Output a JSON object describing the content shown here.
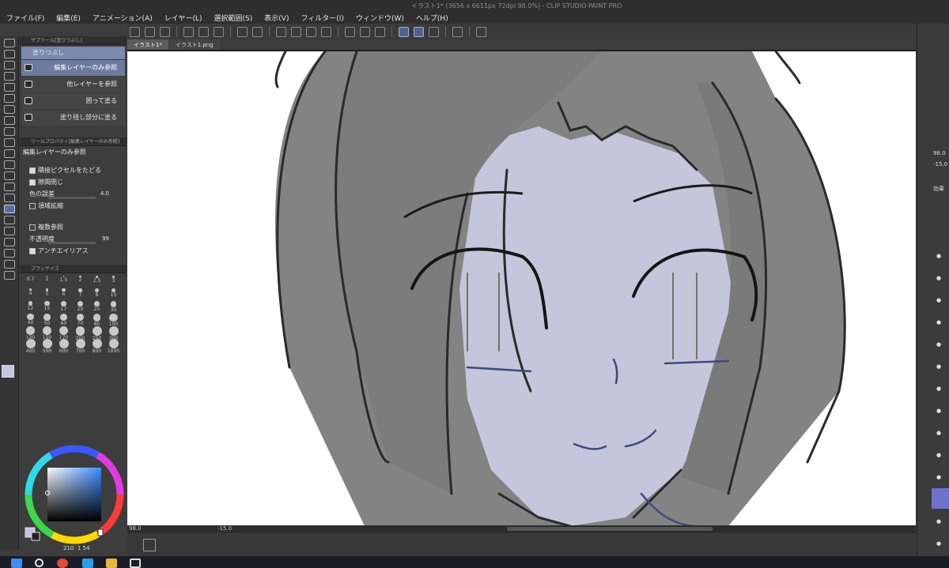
{
  "app": {
    "title": "イラスト1* (3656 x 6611px 72dpi 98.0%)  - CLIP STUDIO PAINT PRO"
  },
  "menu": [
    "ファイル(F)",
    "編集(E)",
    "アニメーション(A)",
    "レイヤー(L)",
    "選択範囲(S)",
    "表示(V)",
    "フィルター(I)",
    "ウィンドウ(W)",
    "ヘルプ(H)"
  ],
  "tabs": [
    {
      "label": "イラスト1*",
      "active": true
    },
    {
      "label": "イラスト1.png",
      "active": false
    }
  ],
  "subtool_panel": {
    "header": "サブツール[塗りつぶし]",
    "group": "塗りつぶし",
    "items": [
      "編集レイヤーのみ参照",
      "他レイヤーを参照",
      "囲って塗る",
      "塗り残し部分に塗る"
    ],
    "selected": "編集レイヤーのみ参照"
  },
  "tool_property": {
    "header": "ツールプロパティ[編集レイヤーのみ参照]",
    "title": "編集レイヤーのみ参照",
    "rows": [
      {
        "label": "隣接ピクセルをたどる",
        "checked": true
      },
      {
        "label": "隙間閉じ",
        "checked": true
      },
      {
        "label": "色の誤差",
        "value": "4.0"
      },
      {
        "label": "領域拡縮",
        "checked": false
      },
      {
        "label": "複数参照",
        "checked": false
      },
      {
        "label": "不透明度",
        "value": "99"
      },
      {
        "label": "アンチエイリアス",
        "checked": true
      }
    ]
  },
  "brush_size": {
    "header": "ブラシサイズ",
    "sizes": [
      "0.7",
      "1",
      "1.5",
      "2",
      "2.5",
      "3",
      "4",
      "5",
      "6",
      "7",
      "8",
      "10",
      "12",
      "15",
      "17",
      "20",
      "25",
      "30",
      "40",
      "50",
      "60",
      "70",
      "80",
      "100",
      "120",
      "150",
      "170",
      "200",
      "250",
      "300",
      "400",
      "500",
      "600",
      "700",
      "800",
      "1000"
    ]
  },
  "color": {
    "main": "#c2c6e0",
    "hsv_readout": [
      "210",
      "1",
      "54"
    ]
  },
  "navigator": {
    "zoom": "98.0",
    "angle": "-15.0"
  },
  "right_panel": {
    "values": [
      "98.0",
      "-15.0"
    ],
    "label": "効果"
  },
  "illustration": {
    "hair_color": "#838383",
    "skin_color": "#c5c6dc",
    "line_color": "#2a2a2a",
    "accent_line_color": "#3e4a7d"
  }
}
